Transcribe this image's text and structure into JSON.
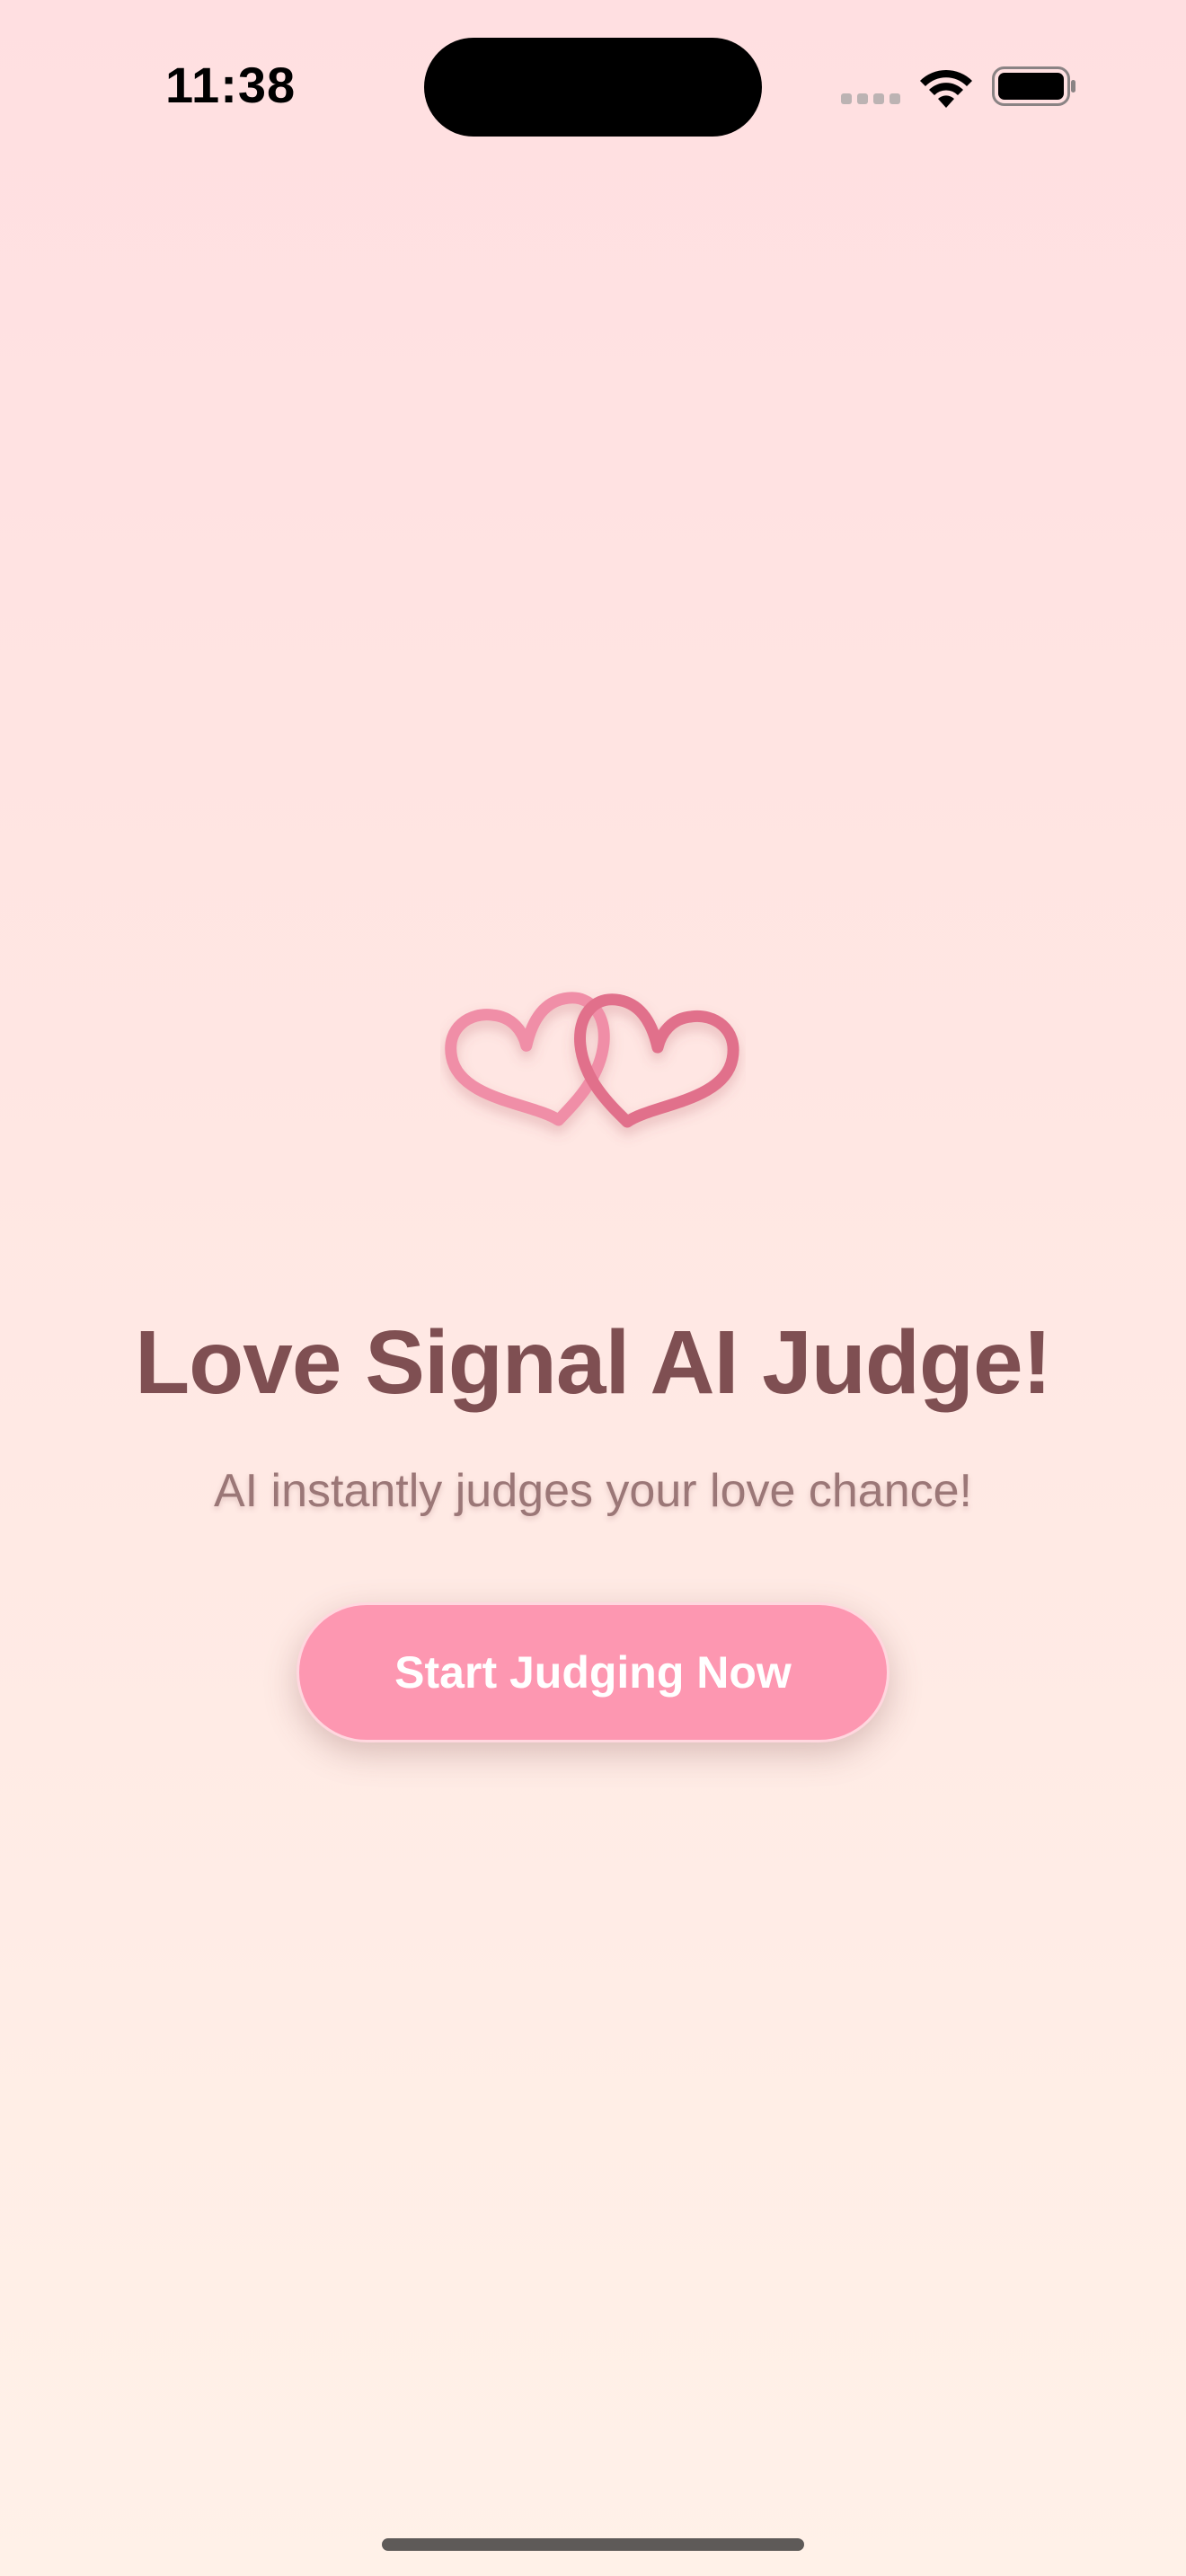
{
  "status_bar": {
    "time": "11:38"
  },
  "main": {
    "icon": "interlocking-hearts-icon",
    "title": "Love Signal AI Judge!",
    "subtitle": "AI instantly judges your love chance!",
    "start_button_label": "Start Judging Now"
  },
  "colors": {
    "background_top": "#ffdfe1",
    "background_bottom": "#fff1e8",
    "title": "#7f4f52",
    "subtitle": "#9b7777",
    "button": "#fd97b1",
    "heart_left": "#f08ea7",
    "heart_right": "#e16f8b"
  }
}
